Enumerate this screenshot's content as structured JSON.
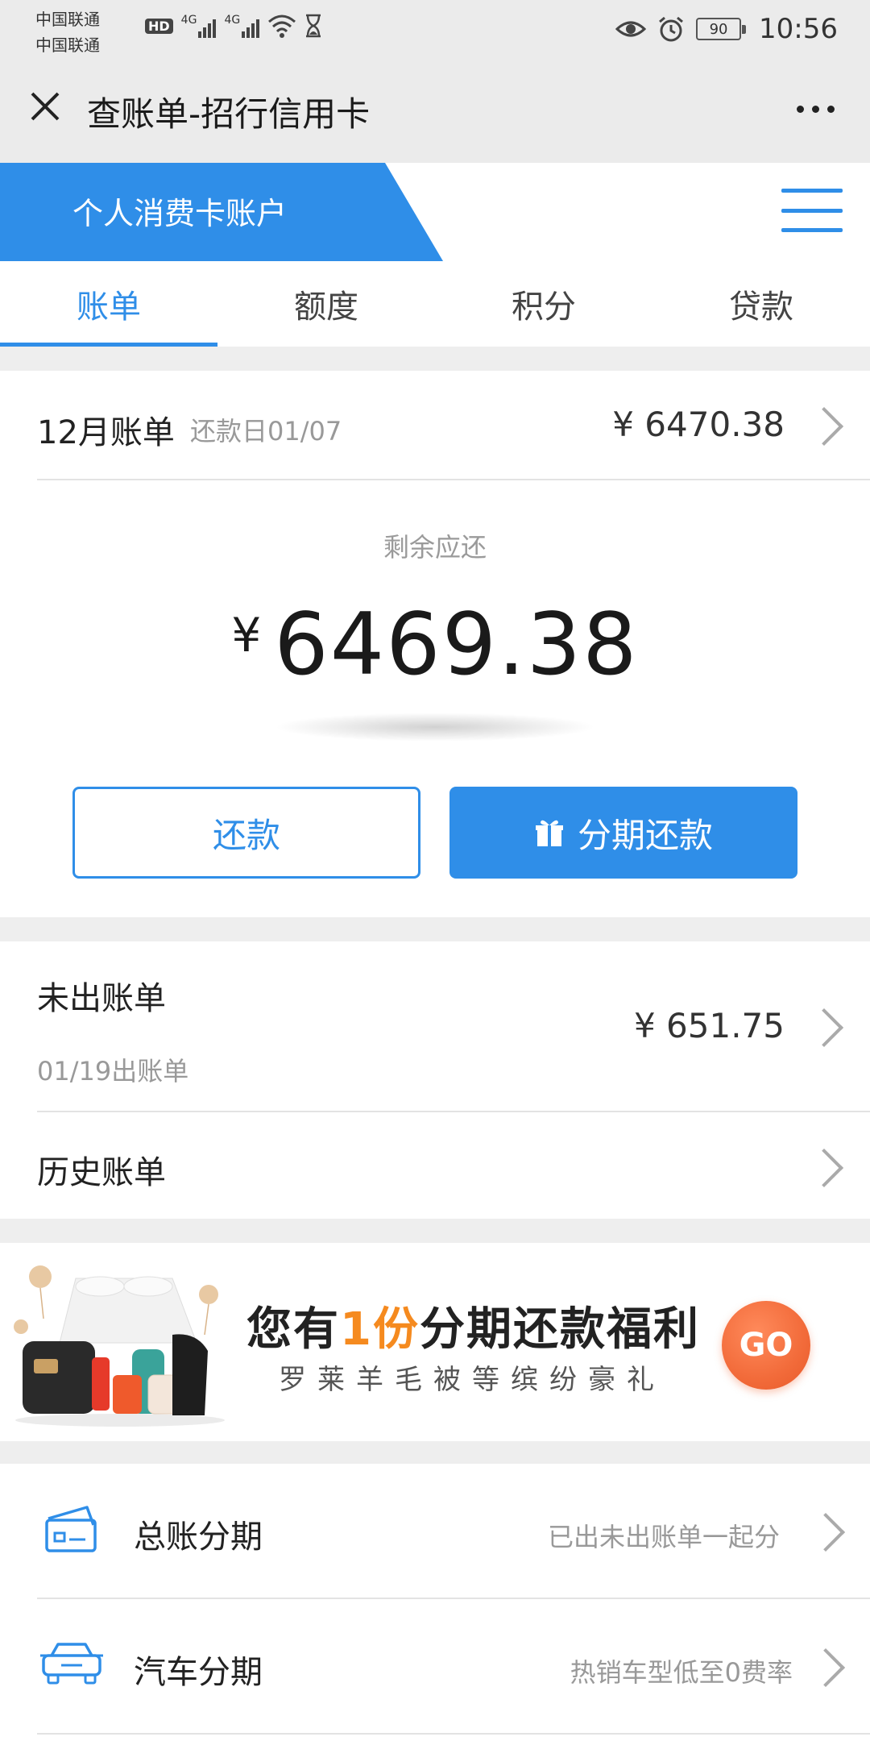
{
  "status_bar": {
    "carrier1": "中国联通",
    "carrier2": "中国联通",
    "hd": "HD",
    "net1": "4G",
    "net2": "4G",
    "battery": "90",
    "time": "10:56"
  },
  "header": {
    "title": "查账单-招行信用卡"
  },
  "account": {
    "label": "个人消费卡账户"
  },
  "tabs": [
    {
      "label": "账单"
    },
    {
      "label": "额度"
    },
    {
      "label": "积分"
    },
    {
      "label": "贷款"
    }
  ],
  "statement": {
    "title": "12月账单",
    "due": "还款日01/07",
    "amount": "¥ 6470.38",
    "remaining_label": "剩余应还",
    "remaining_currency": "¥",
    "remaining_amount": "6469.38",
    "repay_label": "还款",
    "installment_label": "分期还款"
  },
  "unbilled": {
    "title": "未出账单",
    "sub": "01/19出账单",
    "amount": "¥ 651.75"
  },
  "history": {
    "title": "历史账单"
  },
  "promo": {
    "line1_pre": "您有",
    "line1_highlight": "1份",
    "line1_post": "分期还款福利",
    "line2": "罗莱羊毛被等缤纷豪礼",
    "go": "GO"
  },
  "list": [
    {
      "label": "总账分期",
      "hint": "已出未出账单一起分"
    },
    {
      "label": "汽车分期",
      "hint": "热销车型低至0费率"
    }
  ],
  "colors": {
    "accent": "#2f8ee8",
    "highlight": "#f58a1f",
    "go": "#f26b3a"
  }
}
